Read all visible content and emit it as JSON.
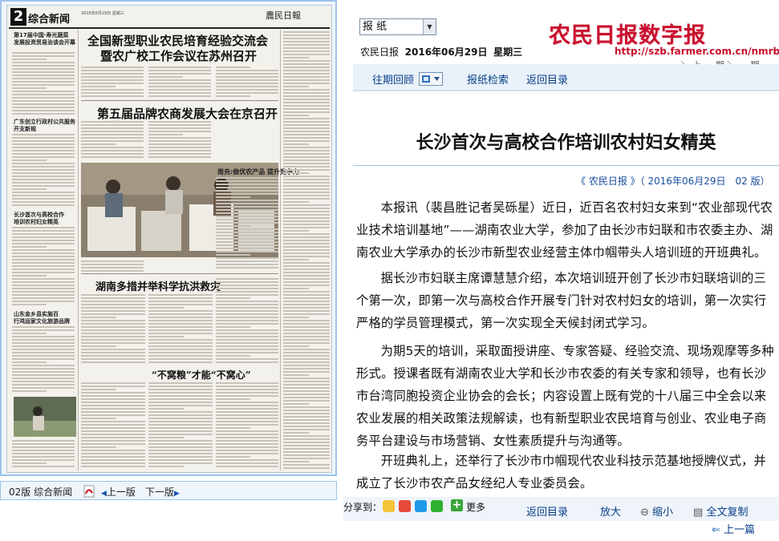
{
  "left_panel": {
    "newspaper": {
      "page_num": "2",
      "section": "综合新闻",
      "masthead_logo": "農民日報",
      "masthead_date": "2016年6月29日 星期三",
      "headlines": [
        "全国新型职业农民培育经验交流会",
        "暨农广校工作会议在苏州召开",
        "第五届品牌农商发展大会在京召开",
        "南充:做优农产品 提升竞争力",
        "湖南多措并举科学抗洪救灾",
        "“不窝粮”才能“不窝心”"
      ],
      "side_heads": [
        "第17届中国·寿光蔬菜",
        "发展投资贸易治谈会开幕",
        "广东创立行政村公共服务",
        "开支新规",
        "长沙首次与高校合作",
        "培训农村妇女精英",
        "山东金乡县实施百",
        "行鸿运家文化旅游品牌"
      ]
    },
    "bottom_bar": {
      "page_label": "02版 综合新闻",
      "prev_page": "上一版",
      "next_page": "下一版"
    }
  },
  "header": {
    "paper_select": "报 纸",
    "paper_name": "农民日报",
    "date": "2016年06月29日",
    "weekday": "星期三",
    "brand": "农民日报数字报",
    "url": "http://szb.farmer.com.cn/nmrb",
    "arc_text": "、 ＼ 上 一 期 ＼ 一 期 "
  },
  "nav": {
    "history": "往期回顾",
    "search": "报纸检索",
    "catalog": "返回目录"
  },
  "article": {
    "title": "长沙首次与高校合作培训农村妇女精英",
    "meta": "《 农民日报 》（ 2016年06月29日　02 版）",
    "paragraphs": [
      "本报讯（裴昌胜记者吴砾星）近日，近百名农村妇女来到“农业部现代农业技术培训基地”——湖南农业大学，参加了由长沙市妇联和市农委主办、湖南农业大学承办的长沙市新型农业经营主体巾帼带头人培训班的开班典礼。",
      "据长沙市妇联主席谭慧慧介绍，本次培训班开创了长沙市妇联培训的三个第一次，即第一次与高校合作开展专门针对农村妇女的培训，第一次实行严格的学员管理模式，第一次实现全天候封闭式学习。",
      "为期5天的培训，采取面授讲座、专家答疑、经验交流、现场观摩等多种形式。授课者既有湖南农业大学和长沙市农委的有关专家和领导，也有长沙市台湾同胞投资企业协会的会长；内容设置上既有党的十八届三中全会以来农业发展的相关政策法规解读，也有新型职业农民培育与创业、农业电子商务平台建设与市场营销、女性素质提升与沟通等。",
      "开班典礼上，还举行了长沙市巾帼现代农业科技示范基地授牌仪式，并成立了长沙市农产品女经纪人专业委员会。"
    ]
  },
  "share": {
    "label": "分享到：",
    "more": "更多",
    "icons": [
      "qzone-icon",
      "weibo-icon",
      "qq-icon",
      "wechat-icon"
    ]
  },
  "tools": {
    "back": "返回目录",
    "zoom_in": "放大",
    "zoom_out": "缩小",
    "copy_all": "全文复制",
    "prev_article": "上一篇"
  },
  "colors": {
    "brand_red": "#c8102e",
    "link_blue": "#0b3f8a",
    "panel_border": "#9cc3e6"
  }
}
